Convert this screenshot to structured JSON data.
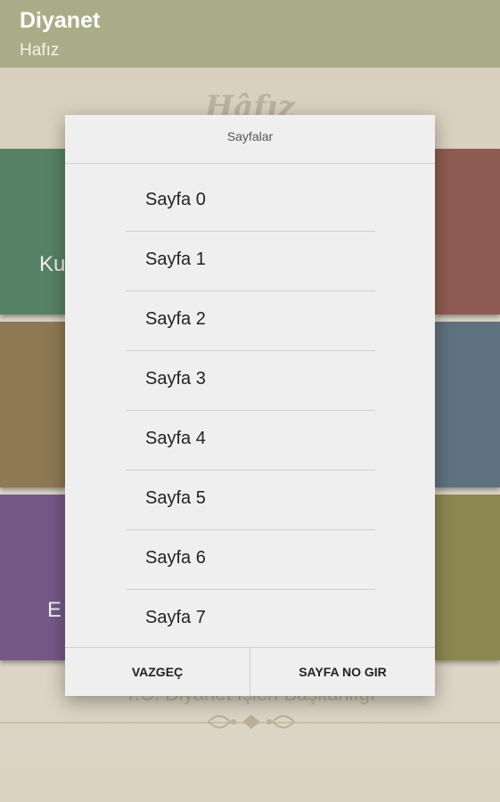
{
  "app_bar": {
    "title": "Diyanet",
    "subtitle": "Hafız"
  },
  "background": {
    "heading": "Hâfız",
    "tiles": [
      {
        "label": "Ku",
        "color": "#5e8b6c"
      },
      {
        "label": "",
        "color": "#9a6158"
      },
      {
        "label": "",
        "color": "#98805a"
      },
      {
        "label": "",
        "color": "#657a88"
      },
      {
        "label": "E",
        "color": "#7c5f8f"
      },
      {
        "label": "",
        "color": "#969157"
      }
    ],
    "footer": "T.C. Diyanet İşleri Başkanlığı"
  },
  "dialog": {
    "title": "Sayfalar",
    "items": [
      "Sayfa 0",
      "Sayfa 1",
      "Sayfa 2",
      "Sayfa 3",
      "Sayfa 4",
      "Sayfa 5",
      "Sayfa 6",
      "Sayfa 7"
    ],
    "cancel_label": "VAZGEÇ",
    "enter_page_label": "SAYFA NO GIR"
  }
}
